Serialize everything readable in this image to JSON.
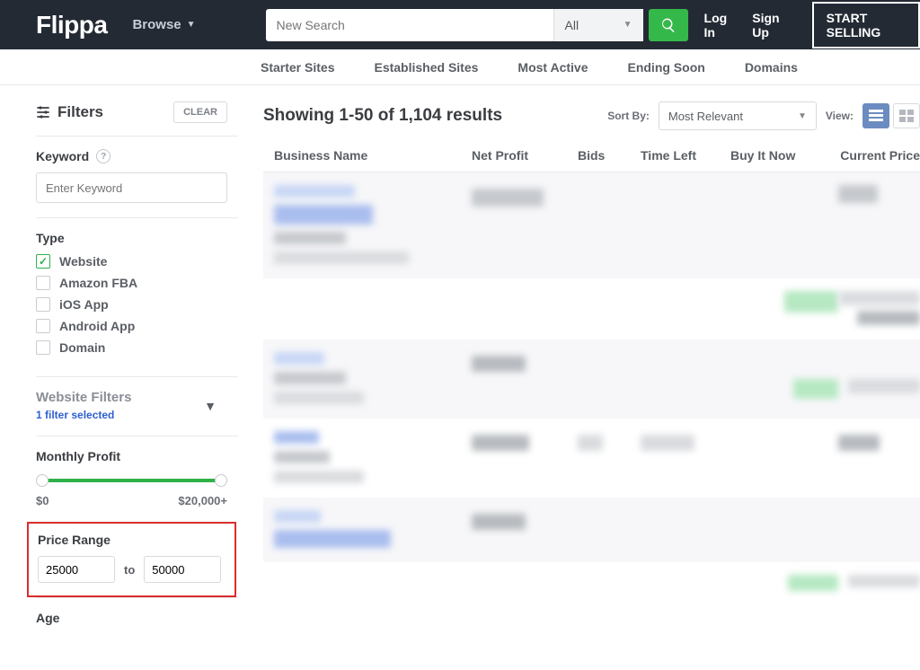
{
  "header": {
    "logo": "Flippa",
    "browse": "Browse",
    "search_placeholder": "New Search",
    "search_category": "All",
    "login": "Log In",
    "signup": "Sign Up",
    "start_selling": "START SELLING"
  },
  "tabs": {
    "starter": "Starter Sites",
    "established": "Established Sites",
    "active": "Most Active",
    "ending": "Ending Soon",
    "domains": "Domains"
  },
  "filters": {
    "title": "Filters",
    "clear": "CLEAR",
    "keyword_label": "Keyword",
    "keyword_placeholder": "Enter Keyword",
    "type_label": "Type",
    "types": {
      "website": "Website",
      "amazon_fba": "Amazon FBA",
      "ios_app": "iOS App",
      "android_app": "Android App",
      "domain": "Domain"
    },
    "website_filters": {
      "title": "Website Filters",
      "selected": "1 filter selected"
    },
    "monthly_profit": {
      "label": "Monthly Profit",
      "min": "$0",
      "max": "$20,000+"
    },
    "price_range": {
      "label": "Price Range",
      "min": "25000",
      "to": "to",
      "max": "50000"
    },
    "age_label": "Age"
  },
  "results": {
    "title": "Showing 1-50 of 1,104 results",
    "sort_by_label": "Sort By:",
    "sort_value": "Most Relevant",
    "view_label": "View:",
    "columns": {
      "name": "Business Name",
      "profit": "Net Profit",
      "bids": "Bids",
      "time": "Time Left",
      "buy": "Buy It Now",
      "price": "Current Price"
    }
  }
}
